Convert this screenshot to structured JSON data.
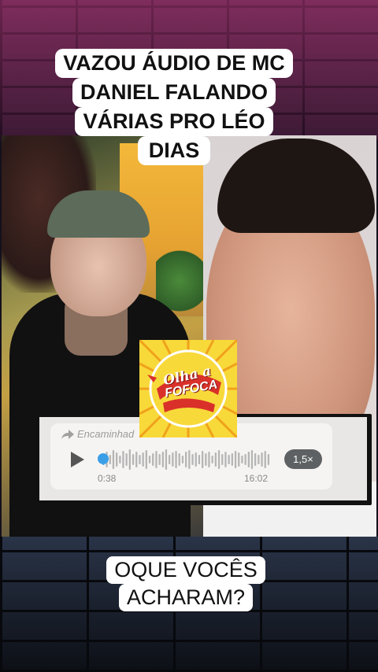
{
  "headline": {
    "lines": [
      "VAZOU ÁUDIO DE MC",
      "DANIEL FALANDO",
      "VÁRIAS PRO LÉO",
      "DIAS"
    ]
  },
  "audio_message": {
    "forwarded_label": "Encaminhad",
    "elapsed": "0:38",
    "timestamp": "16:02",
    "playback_speed": "1,5×",
    "accent_color": "#3b9fe8"
  },
  "logo": {
    "line1": "Olha a",
    "line2": "FOFOCA",
    "colors": {
      "background": "#f8d93a",
      "primary": "#d9312a"
    }
  },
  "question": {
    "lines": [
      "OQUE VOCÊS",
      "ACHARAM?"
    ]
  }
}
